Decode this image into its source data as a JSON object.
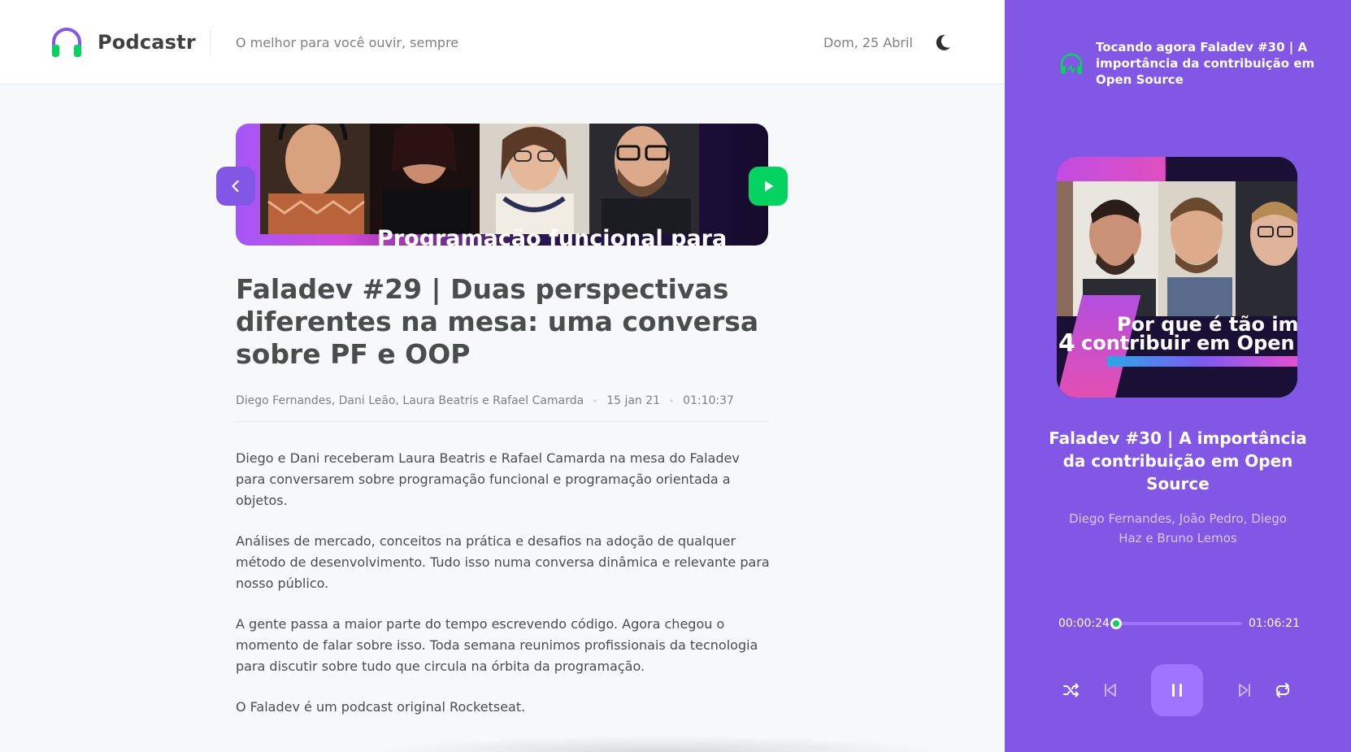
{
  "header": {
    "app_name": "Podcastr",
    "tagline": "O melhor para você ouvir, sempre",
    "date": "Dom, 25 Abril",
    "theme_icon": "moon-icon"
  },
  "episode": {
    "cover_caption": "Programação funcional para",
    "title": "Faladev #29 | Duas perspectivas diferentes na mesa: uma conversa sobre PF e OOP",
    "members": "Diego Fernandes, Dani Leão, Laura Beatris e Rafael Camarda",
    "published_at": "15 jan 21",
    "duration": "01:10:37",
    "description": [
      "Diego e Dani receberam Laura Beatris e Rafael Camarda na mesa do Faladev para conversarem sobre programação funcional e programação orientada a objetos.",
      "Análises de mercado, conceitos na prática e desafios na adoção de qualquer método de desenvolvimento. Tudo isso numa conversa dinâmica e relevante para nosso público.",
      "A gente passa a maior parte do tempo escrevendo código. Agora chegou o momento de falar sobre isso. Toda semana reunimos profissionais da tecnologia para discutir sobre tudo que circula na órbita da programação.",
      "O Faladev é um podcast original Rocketseat."
    ]
  },
  "player": {
    "now_playing": "Tocando agora Faladev #30 | A importância da contribuição em Open Source",
    "thumb_caption_line1": "Por que é tão imp",
    "thumb_caption_line2": "contribuir em Open S",
    "thumb_number": "4",
    "title": "Faladev #30 | A importância da contribuição em Open Source",
    "members": "Diego Fernandes, João Pedro, Diego Haz e Bruno Lemos",
    "current_time": "00:00:24",
    "total_time": "01:06:21",
    "progress": 0.006,
    "state": "playing"
  },
  "colors": {
    "purple": "#8257e5",
    "purple_light": "#9f75ff",
    "green": "#04d361",
    "text": "#494d4b",
    "muted": "#808080"
  }
}
